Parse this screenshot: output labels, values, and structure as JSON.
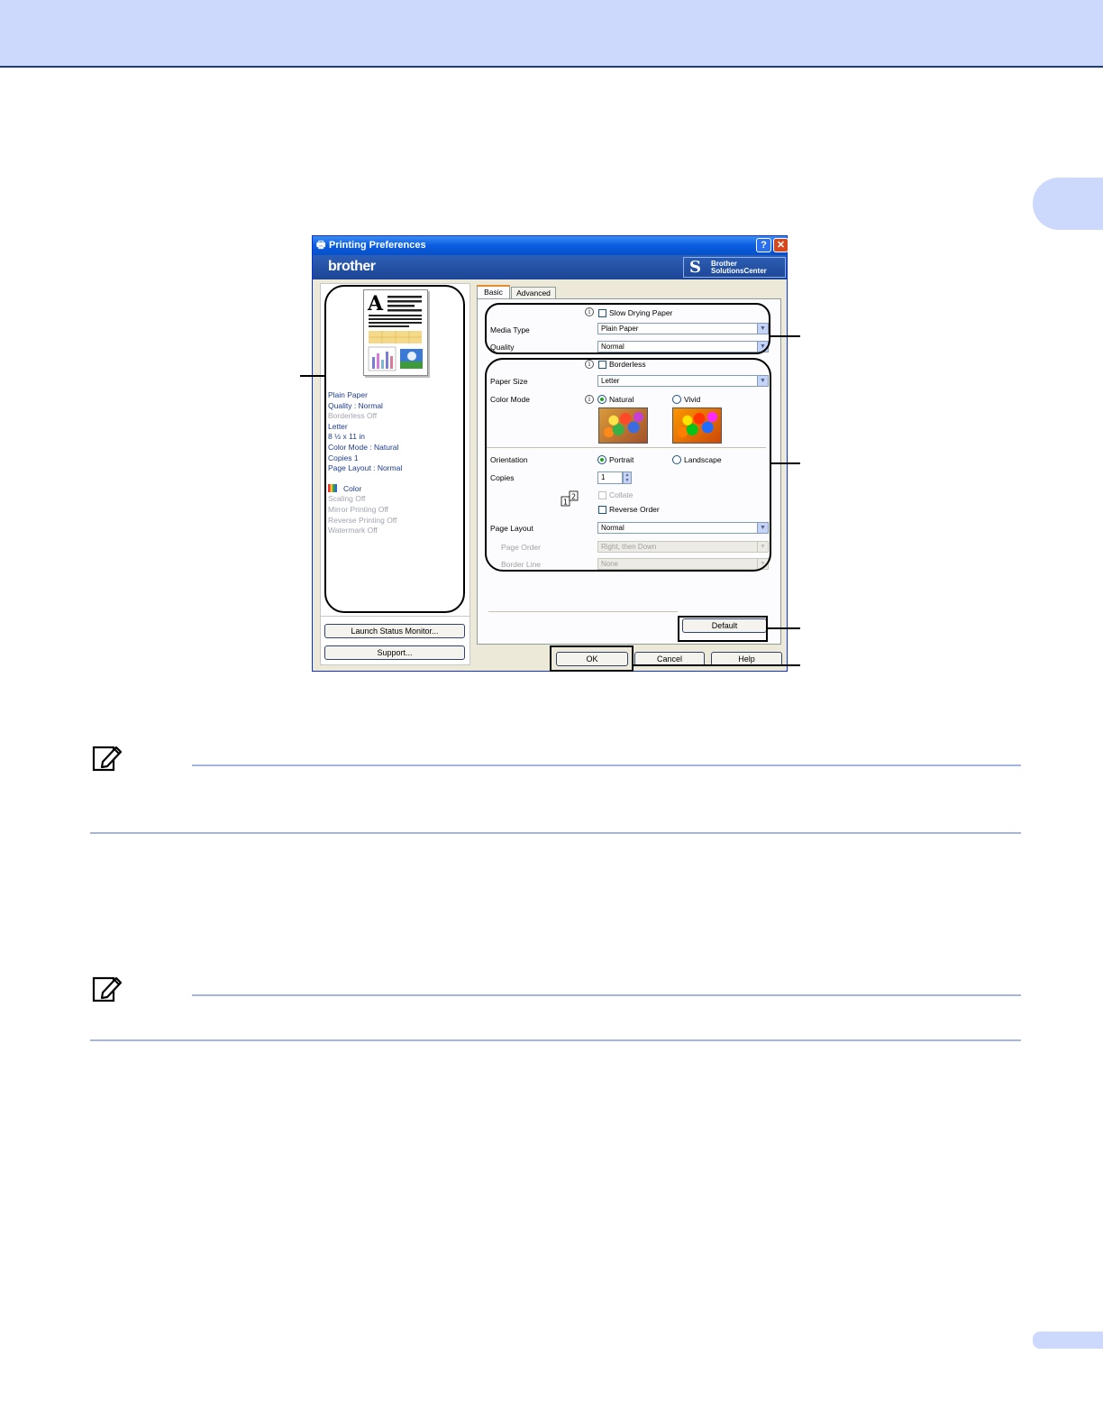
{
  "dialog": {
    "title": "Printing Preferences",
    "help_glyph": "?",
    "close_glyph": "✕",
    "brand": "brother",
    "solutions_line1": "Brother",
    "solutions_line2": "SolutionsCenter"
  },
  "summary": {
    "dark_lines": [
      "Plain Paper",
      "Quality : Normal"
    ],
    "borderless": "Borderless Off",
    "dark_lines2": [
      "Letter",
      "8 ½ x 11 in",
      "Color Mode : Natural",
      "Copies 1",
      "Page Layout : Normal"
    ],
    "color": "Color",
    "grey_lines": [
      "Scaling Off",
      "Mirror Printing Off",
      "Reverse Printing Off",
      "Watermark Off"
    ]
  },
  "buttons": {
    "launch_status": "Launch Status Monitor...",
    "support": "Support...",
    "default": "Default",
    "ok": "OK",
    "cancel": "Cancel",
    "help": "Help"
  },
  "tabs": [
    "Basic",
    "Advanced"
  ],
  "basic": {
    "slow_drying": "Slow Drying Paper",
    "media_type_label": "Media Type",
    "media_type_value": "Plain Paper",
    "quality_label": "Quality",
    "quality_value": "Normal",
    "borderless": "Borderless",
    "paper_size_label": "Paper Size",
    "paper_size_value": "Letter",
    "color_mode_label": "Color Mode",
    "natural": "Natural",
    "vivid": "Vivid",
    "orientation_label": "Orientation",
    "portrait": "Portrait",
    "landscape": "Landscape",
    "copies_label": "Copies",
    "copies_value": "1",
    "collate": "Collate",
    "reverse_order": "Reverse Order",
    "page_layout_label": "Page Layout",
    "page_layout_value": "Normal",
    "page_order_label": "Page Order",
    "page_order_value": "Right, then Down",
    "border_line_label": "Border Line",
    "border_line_value": "None"
  },
  "icons": {
    "printer": "printer-icon",
    "info": "info-icon",
    "note": "note-pencil-icon"
  },
  "colors": {
    "header_band": "#ccd9fd",
    "header_rule": "#1a3d86",
    "note_rule": "#a4b6e0"
  }
}
